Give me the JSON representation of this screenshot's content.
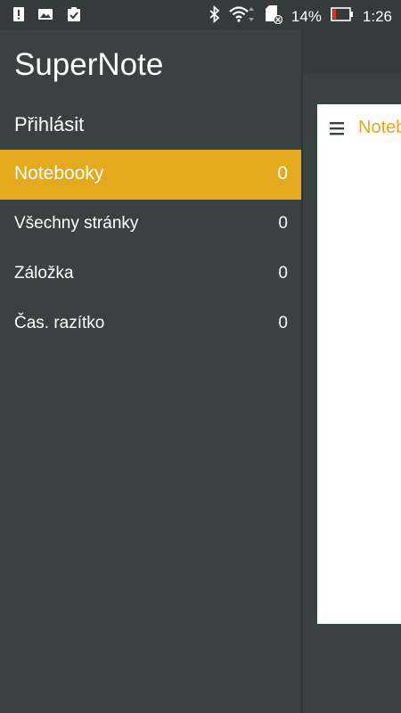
{
  "status_bar": {
    "battery_percent": "14%",
    "time": "1:26",
    "icons": [
      "alert-icon",
      "image-icon",
      "clipboard-check-icon",
      "bluetooth-icon",
      "wifi-icon",
      "sd-card-icon",
      "battery-icon"
    ],
    "battery_level": 0.14
  },
  "drawer": {
    "app_title": "SuperNote",
    "login_label": "Přihlásit",
    "items": [
      {
        "label": "Notebooky",
        "count": "0"
      },
      {
        "label": "Všechny stránky",
        "count": "0"
      },
      {
        "label": "Záložka",
        "count": "0"
      },
      {
        "label": "Čas. razítko",
        "count": "0"
      }
    ]
  },
  "main": {
    "card_title": "Notebooky"
  },
  "colors": {
    "accent": "#e5a91e",
    "background": "#3a4141",
    "card": "#ffffff",
    "text": "#ffffff"
  }
}
